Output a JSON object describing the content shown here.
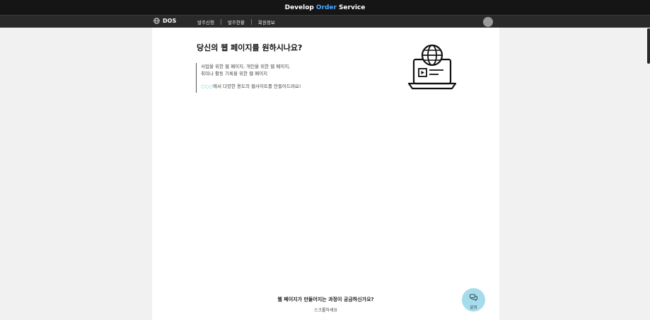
{
  "titlebar": {
    "prefix": "Develop",
    "accent": "Order",
    "suffix": "Service",
    "accent_color": "#4fa6ff"
  },
  "nav": {
    "brand": "DOS",
    "items": [
      {
        "label": "발주신청"
      },
      {
        "label": "발주현황"
      },
      {
        "label": "회원정보"
      }
    ]
  },
  "hero": {
    "title": "당신의 웹 페이지를 원하시나요?",
    "line1": "사업을 위한 웹 페이지, 개인을 위한 웹 페이지,",
    "line2": "취미나 활동 기록을 위한 웹 페이지",
    "line3_accent": "○○○",
    "line3_rest": "에서 다양한 용도의 웹사이트를 만들어드려요!",
    "accent_color": "#63c6d9"
  },
  "bottom": {
    "question": "웹 페이지가 만들어지는 과정이 궁금하신가요?",
    "scroll_hint": "스크롤하세요"
  },
  "chat": {
    "label": "문의"
  },
  "icons": {
    "brand": "globe-icon",
    "hero": "laptop-globe-icon",
    "scroll": "chevron-down-icon",
    "chat": "chat-bubbles-icon"
  }
}
